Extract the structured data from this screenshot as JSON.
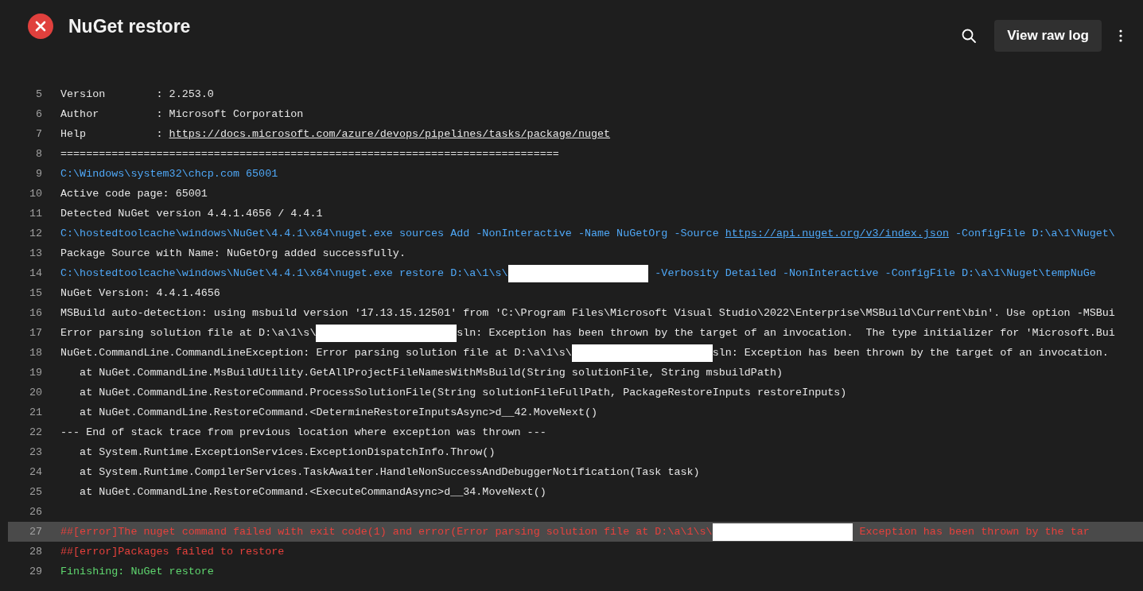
{
  "header": {
    "title": "NuGet restore",
    "status": {
      "kind": "failed"
    },
    "actions": {
      "search": true,
      "view_raw_log": "View raw log",
      "more": true
    }
  },
  "log": [
    {
      "number": "5",
      "kind": "plain",
      "selected": false,
      "segments": [
        {
          "kind": "text",
          "text": "Version        : 2.253.0"
        }
      ]
    },
    {
      "number": "6",
      "kind": "plain",
      "selected": false,
      "segments": [
        {
          "kind": "text",
          "text": "Author         : Microsoft Corporation"
        }
      ]
    },
    {
      "number": "7",
      "kind": "plain",
      "selected": false,
      "segments": [
        {
          "kind": "text",
          "text": "Help           : "
        },
        {
          "kind": "link",
          "text": "https://docs.microsoft.com/azure/devops/pipelines/tasks/package/nuget"
        }
      ]
    },
    {
      "number": "8",
      "kind": "plain",
      "selected": false,
      "segments": [
        {
          "kind": "text",
          "text": "=============================================================================="
        }
      ]
    },
    {
      "number": "9",
      "kind": "command",
      "selected": false,
      "segments": [
        {
          "kind": "text",
          "text": "C:\\Windows\\system32\\chcp.com 65001"
        }
      ]
    },
    {
      "number": "10",
      "kind": "plain",
      "selected": false,
      "segments": [
        {
          "kind": "text",
          "text": "Active code page: 65001"
        }
      ]
    },
    {
      "number": "11",
      "kind": "plain",
      "selected": false,
      "segments": [
        {
          "kind": "text",
          "text": "Detected NuGet version 4.4.1.4656 / 4.4.1"
        }
      ]
    },
    {
      "number": "12",
      "kind": "command",
      "selected": false,
      "segments": [
        {
          "kind": "text",
          "text": "C:\\hostedtoolcache\\windows\\NuGet\\4.4.1\\x64\\nuget.exe sources Add -NonInteractive -Name NuGetOrg -Source "
        },
        {
          "kind": "link",
          "text": "https://api.nuget.org/v3/index.json"
        },
        {
          "kind": "text",
          "text": " -ConfigFile D:\\a\\1\\Nuget\\"
        }
      ]
    },
    {
      "number": "13",
      "kind": "plain",
      "selected": false,
      "segments": [
        {
          "kind": "text",
          "text": "Package Source with Name: NuGetOrg added successfully."
        }
      ]
    },
    {
      "number": "14",
      "kind": "command",
      "selected": false,
      "segments": [
        {
          "kind": "text",
          "text": "C:\\hostedtoolcache\\windows\\NuGet\\4.4.1\\x64\\nuget.exe restore D:\\a\\1\\s\\"
        },
        {
          "kind": "redacted"
        },
        {
          "kind": "text",
          "text": " -Verbosity Detailed -NonInteractive -ConfigFile D:\\a\\1\\Nuget\\tempNuGe"
        }
      ]
    },
    {
      "number": "15",
      "kind": "plain",
      "selected": false,
      "segments": [
        {
          "kind": "text",
          "text": "NuGet Version: 4.4.1.4656"
        }
      ]
    },
    {
      "number": "16",
      "kind": "plain",
      "selected": false,
      "segments": [
        {
          "kind": "text",
          "text": "MSBuild auto-detection: using msbuild version '17.13.15.12501' from 'C:\\Program Files\\Microsoft Visual Studio\\2022\\Enterprise\\MSBuild\\Current\\bin'. Use option -MSBui"
        }
      ]
    },
    {
      "number": "17",
      "kind": "plain",
      "selected": false,
      "segments": [
        {
          "kind": "text",
          "text": "Error parsing solution file at D:\\a\\1\\s\\"
        },
        {
          "kind": "redacted"
        },
        {
          "kind": "text",
          "text": "sln: Exception has been thrown by the target of an invocation.  The type initializer for 'Microsoft.Bui"
        }
      ]
    },
    {
      "number": "18",
      "kind": "plain",
      "selected": false,
      "segments": [
        {
          "kind": "text",
          "text": "NuGet.CommandLine.CommandLineException: Error parsing solution file at D:\\a\\1\\s\\"
        },
        {
          "kind": "redacted"
        },
        {
          "kind": "text",
          "text": "sln: Exception has been thrown by the target of an invocation."
        }
      ]
    },
    {
      "number": "19",
      "kind": "plain",
      "selected": false,
      "segments": [
        {
          "kind": "text",
          "text": "   at NuGet.CommandLine.MsBuildUtility.GetAllProjectFileNamesWithMsBuild(String solutionFile, String msbuildPath)"
        }
      ]
    },
    {
      "number": "20",
      "kind": "plain",
      "selected": false,
      "segments": [
        {
          "kind": "text",
          "text": "   at NuGet.CommandLine.RestoreCommand.ProcessSolutionFile(String solutionFileFullPath, PackageRestoreInputs restoreInputs)"
        }
      ]
    },
    {
      "number": "21",
      "kind": "plain",
      "selected": false,
      "segments": [
        {
          "kind": "text",
          "text": "   at NuGet.CommandLine.RestoreCommand.<DetermineRestoreInputsAsync>d__42.MoveNext()"
        }
      ]
    },
    {
      "number": "22",
      "kind": "plain",
      "selected": false,
      "segments": [
        {
          "kind": "text",
          "text": "--- End of stack trace from previous location where exception was thrown ---"
        }
      ]
    },
    {
      "number": "23",
      "kind": "plain",
      "selected": false,
      "segments": [
        {
          "kind": "text",
          "text": "   at System.Runtime.ExceptionServices.ExceptionDispatchInfo.Throw()"
        }
      ]
    },
    {
      "number": "24",
      "kind": "plain",
      "selected": false,
      "segments": [
        {
          "kind": "text",
          "text": "   at System.Runtime.CompilerServices.TaskAwaiter.HandleNonSuccessAndDebuggerNotification(Task task)"
        }
      ]
    },
    {
      "number": "25",
      "kind": "plain",
      "selected": false,
      "segments": [
        {
          "kind": "text",
          "text": "   at NuGet.CommandLine.RestoreCommand.<ExecuteCommandAsync>d__34.MoveNext()"
        }
      ]
    },
    {
      "number": "26",
      "kind": "plain",
      "selected": false
    },
    {
      "number": "27",
      "kind": "error",
      "selected": true,
      "segments": [
        {
          "kind": "text",
          "text": "##[error]The nuget command failed with exit code(1) and error(Error parsing solution file at D:\\a\\1\\s\\"
        },
        {
          "kind": "redacted"
        },
        {
          "kind": "text",
          "text": " Exception has been thrown by the tar"
        }
      ]
    },
    {
      "number": "28",
      "kind": "error",
      "selected": false,
      "segments": [
        {
          "kind": "text",
          "text": "##[error]Packages failed to restore"
        }
      ]
    },
    {
      "number": "29",
      "kind": "success",
      "selected": false,
      "segments": [
        {
          "kind": "text",
          "text": "Finishing: NuGet restore"
        }
      ]
    }
  ]
}
